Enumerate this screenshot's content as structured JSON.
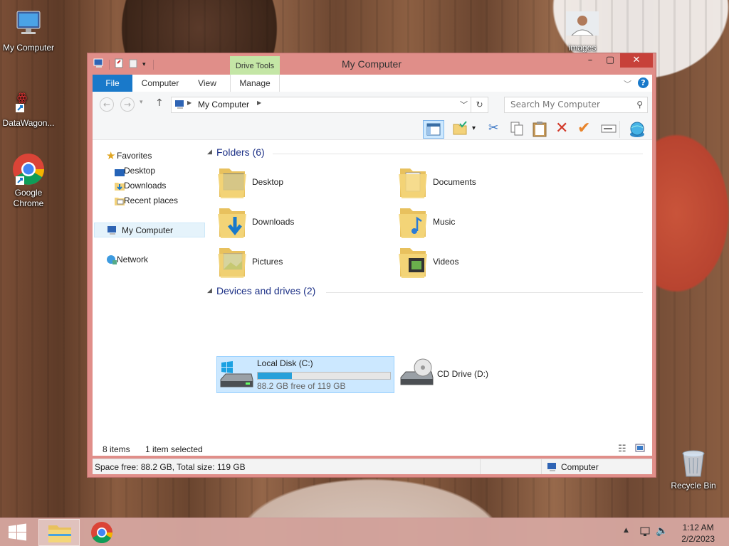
{
  "desktop": {
    "icons": [
      {
        "label": "My Computer"
      },
      {
        "label": "DataWagon..."
      },
      {
        "label": "Google Chrome"
      },
      {
        "label": "images"
      },
      {
        "label": "Recycle Bin"
      }
    ]
  },
  "window": {
    "title": "My Computer",
    "contextual_tab": "Drive Tools",
    "tabs": [
      "File",
      "Computer",
      "View",
      "Manage"
    ],
    "address": {
      "location": "My Computer"
    },
    "search": {
      "placeholder": "Search My Computer"
    },
    "nav": {
      "favorites": "Favorites",
      "favorite_items": [
        "Desktop",
        "Downloads",
        "Recent places"
      ],
      "this_pc": "My Computer",
      "network": "Network"
    },
    "folders_header": "Folders (6)",
    "folders": [
      "Desktop",
      "Documents",
      "Downloads",
      "Music",
      "Pictures",
      "Videos"
    ],
    "drives_header": "Devices and drives (2)",
    "drives": [
      {
        "name": "Local Disk (C:)",
        "space": "88.2 GB free of 119 GB",
        "used_fraction": 0.26
      },
      {
        "name": "CD Drive (D:)"
      }
    ],
    "status": {
      "items": "8 items",
      "selected": "1 item selected"
    },
    "info": {
      "space": "Space free: 88.2 GB, Total size: 119 GB",
      "location": "Computer"
    }
  },
  "taskbar": {
    "time": "1:12 AM",
    "date": "2/2/2023"
  },
  "colors": {
    "accent": "#1979ca",
    "titlebar": "#e08e89",
    "selection": "#cce8ff",
    "progress": "#26a0da"
  }
}
